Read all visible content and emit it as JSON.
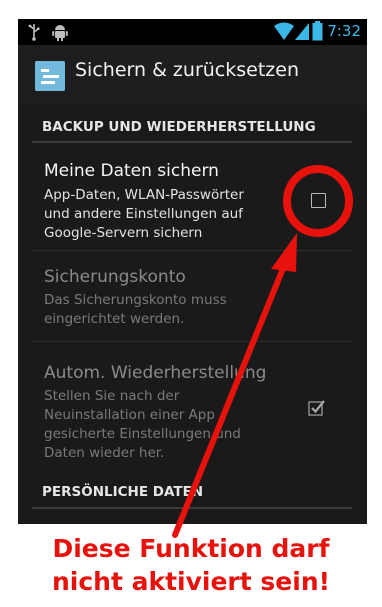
{
  "status_bar": {
    "time": "7:32",
    "icons": [
      "usb-icon",
      "android-debug-icon",
      "wifi-icon",
      "signal-icon",
      "battery-icon"
    ]
  },
  "action_bar": {
    "title": "Sichern & zurücksetzen",
    "icon": "backup-settings-icon"
  },
  "sections": [
    {
      "header": "BACKUP UND WIEDERHERSTELLUNG",
      "items": [
        {
          "title": "Meine Daten sichern",
          "summary": "App-Daten, WLAN-Passwörter\nund andere Einstellungen auf\nGoogle-Servern sichern",
          "checked": false,
          "enabled": true
        },
        {
          "title": "Sicherungskonto",
          "summary": "Das Sicherungskonto muss\neingerichtet werden.",
          "enabled": false
        },
        {
          "title": "Autom. Wiederherstellung",
          "summary": "Stellen Sie nach der\nNeuinstallation einer App\ngesicherte Einstellungen und\nDaten wieder her.",
          "checked": true,
          "enabled": false
        }
      ]
    },
    {
      "header": "PERSÖNLICHE DATEN"
    }
  ],
  "annotation": {
    "caption_line1": "Diese Funktion darf",
    "caption_line2": "nicht aktiviert sein!",
    "color": "#e8120c"
  },
  "colors": {
    "accent": "#3bb8e8",
    "background": "#1a1a1a"
  }
}
